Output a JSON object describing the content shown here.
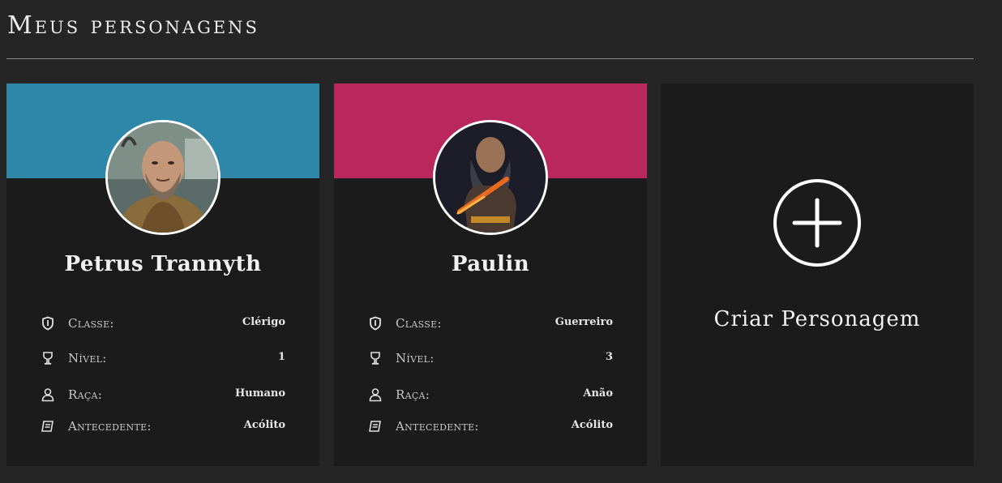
{
  "header": {
    "title": "Meus personagens"
  },
  "colors": {
    "background": "#252525",
    "card_background": "#1b1b1b",
    "banner_blue": "#2e87a8",
    "banner_pink": "#b9275c"
  },
  "stat_labels": {
    "class": "Classe:",
    "level": "Nível:",
    "race": "Raça:",
    "background": "Antecedente:"
  },
  "characters": [
    {
      "name": "Petrus Trannyth",
      "banner_color": "#2e87a8",
      "class": "Clérigo",
      "level": "1",
      "race": "Humano",
      "background": "Acólito"
    },
    {
      "name": "Paulin",
      "banner_color": "#b9275c",
      "class": "Guerreiro",
      "level": "3",
      "race": "Anão",
      "background": "Acólito"
    }
  ],
  "create_card": {
    "label": "Criar Personagem",
    "icon": "plus-circle-icon"
  }
}
